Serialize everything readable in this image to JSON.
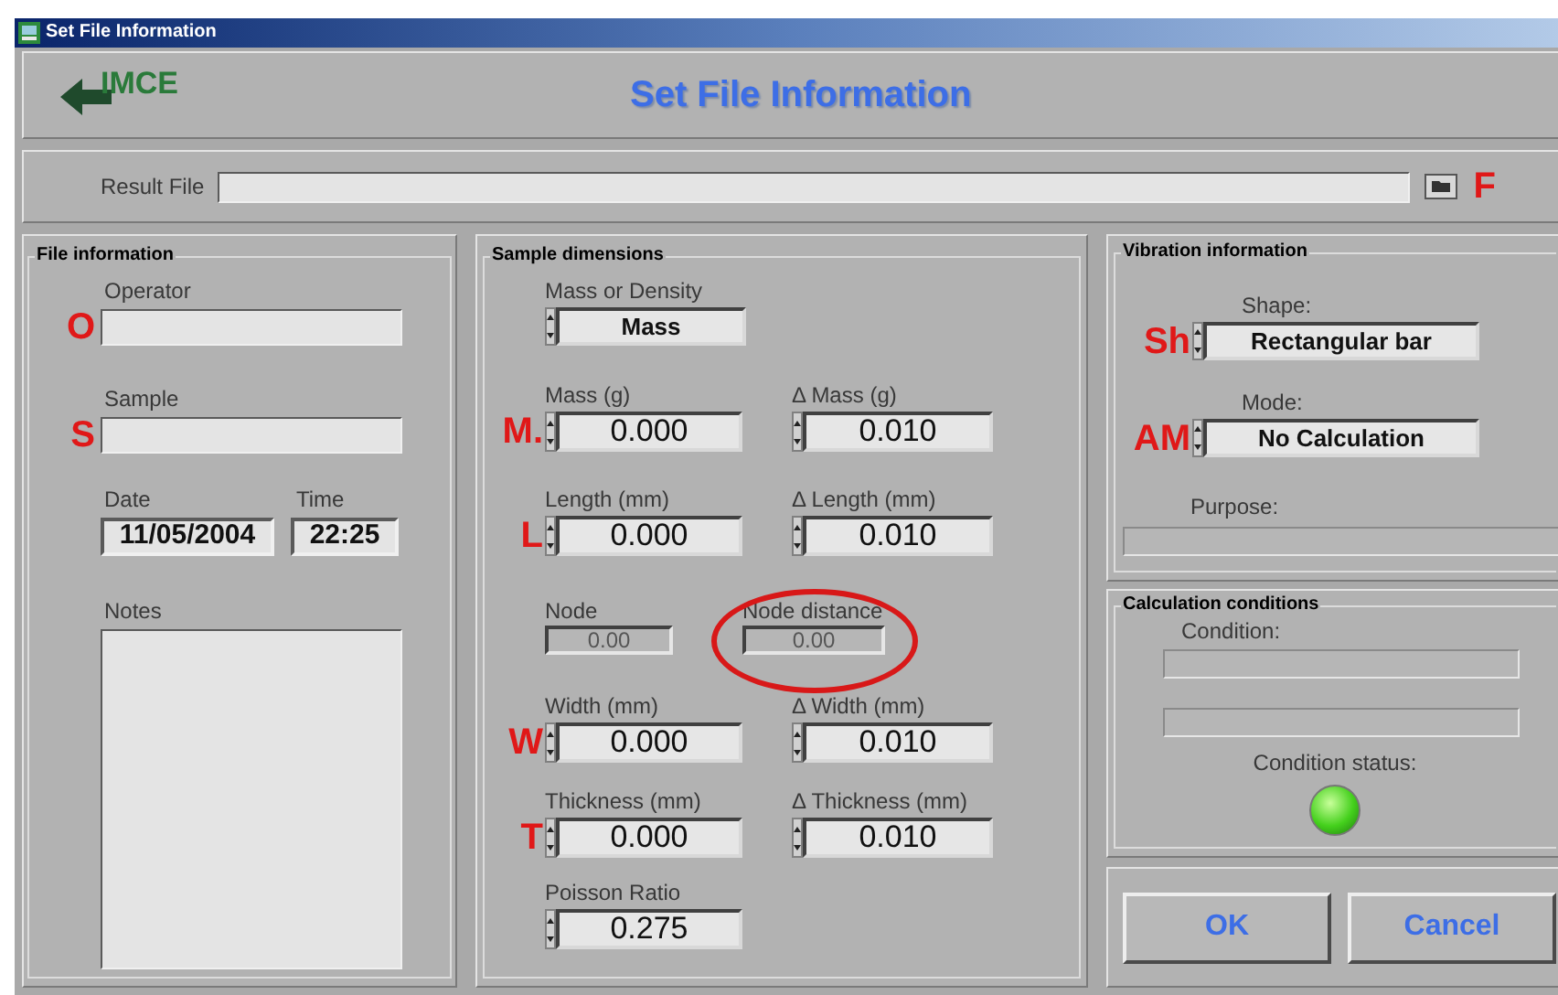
{
  "window": {
    "title": "Set File Information"
  },
  "header": {
    "logo": "IMCE",
    "title": "Set File Information"
  },
  "result_file": {
    "label": "Result File",
    "annotation": "F"
  },
  "file_information": {
    "title": "File information",
    "fields": [
      {
        "label": "Operator",
        "annotation": "O"
      },
      {
        "label": "Sample",
        "annotation": "S"
      }
    ],
    "date": {
      "label": "Date",
      "value": "11/05/2004"
    },
    "time": {
      "label": "Time",
      "value": "22:25"
    },
    "notes": {
      "label": "Notes"
    }
  },
  "sample_dimensions": {
    "title": "Sample dimensions",
    "mass_or_density": {
      "label": "Mass or Density",
      "value": "Mass"
    },
    "rows": [
      {
        "annotation": "M.",
        "value_field": {
          "label": "Mass (g)",
          "value": "0.000"
        },
        "delta_field": {
          "label": "Δ Mass (g)",
          "value": "0.010"
        }
      },
      {
        "annotation": "L",
        "value_field": {
          "label": "Length (mm)",
          "value": "0.000"
        },
        "delta_field": {
          "label": "Δ Length (mm)",
          "value": "0.010"
        }
      }
    ],
    "node": {
      "label": "Node",
      "value": "0.00"
    },
    "node_distance": {
      "label": "Node distance",
      "value": "0.00",
      "circled": true
    },
    "rows_2": [
      {
        "annotation": "W",
        "value_field": {
          "label": "Width (mm)",
          "value": "0.000"
        },
        "delta_field": {
          "label": "Δ Width (mm)",
          "value": "0.010"
        }
      },
      {
        "annotation": "T",
        "value_field": {
          "label": "Thickness (mm)",
          "value": "0.000"
        },
        "delta_field": {
          "label": "Δ Thickness (mm)",
          "value": "0.010"
        }
      }
    ],
    "poisson_ratio": {
      "label": "Poisson Ratio",
      "value": "0.275"
    }
  },
  "vibration_information": {
    "title": "Vibration information",
    "shape": {
      "label": "Shape:",
      "value": "Rectangular bar",
      "annotation": "Sh"
    },
    "mode": {
      "label": "Mode:",
      "value": "No Calculation",
      "annotation": "AM"
    },
    "purpose": {
      "label": "Purpose:"
    }
  },
  "calculation_conditions": {
    "title": "Calculation conditions",
    "condition": {
      "label": "Condition:"
    },
    "status": {
      "label": "Condition status:",
      "on": true
    }
  },
  "buttons": [
    {
      "label": "OK"
    },
    {
      "label": "Cancel"
    }
  ]
}
